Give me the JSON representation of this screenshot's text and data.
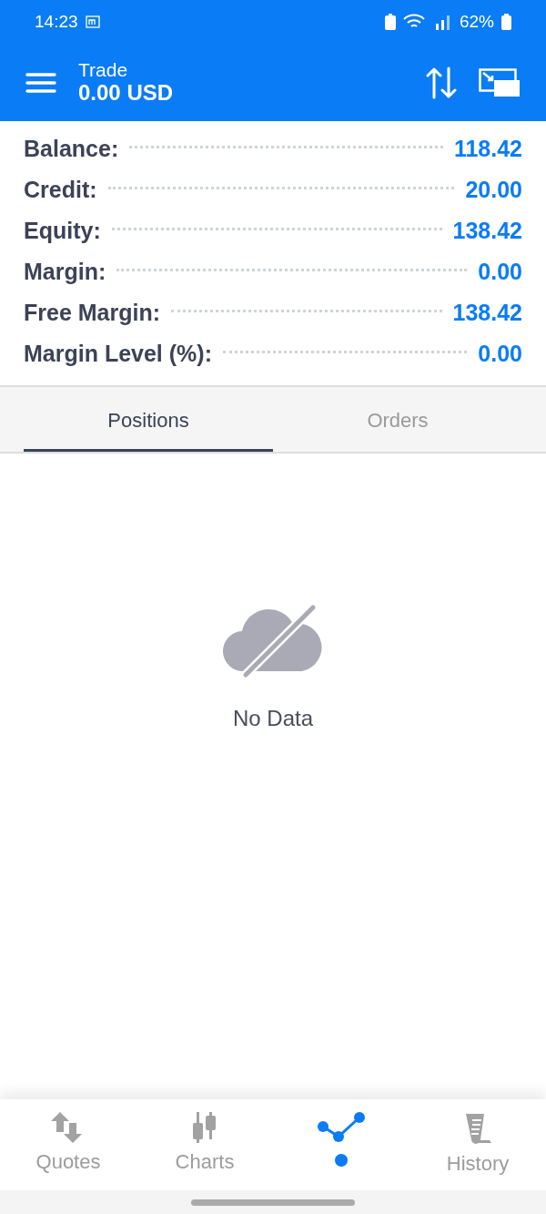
{
  "status_bar": {
    "time": "14:23",
    "battery": "62%"
  },
  "header": {
    "title": "Trade",
    "subtitle": "0.00 USD"
  },
  "summary": [
    {
      "label": "Balance:",
      "value": "118.42"
    },
    {
      "label": "Credit:",
      "value": "20.00"
    },
    {
      "label": "Equity:",
      "value": "138.42"
    },
    {
      "label": "Margin:",
      "value": "0.00"
    },
    {
      "label": "Free Margin:",
      "value": "138.42"
    },
    {
      "label": "Margin Level (%):",
      "value": "0.00"
    }
  ],
  "tabs": [
    {
      "label": "Positions",
      "selected": true
    },
    {
      "label": "Orders",
      "selected": false
    }
  ],
  "empty_state": {
    "message": "No Data"
  },
  "bottom_nav": [
    {
      "kind": "quotes",
      "label": "Quotes",
      "selected": false
    },
    {
      "kind": "charts",
      "label": "Charts",
      "selected": false
    },
    {
      "kind": "trade",
      "selected": true
    },
    {
      "kind": "history",
      "label": "History",
      "selected": false
    }
  ]
}
